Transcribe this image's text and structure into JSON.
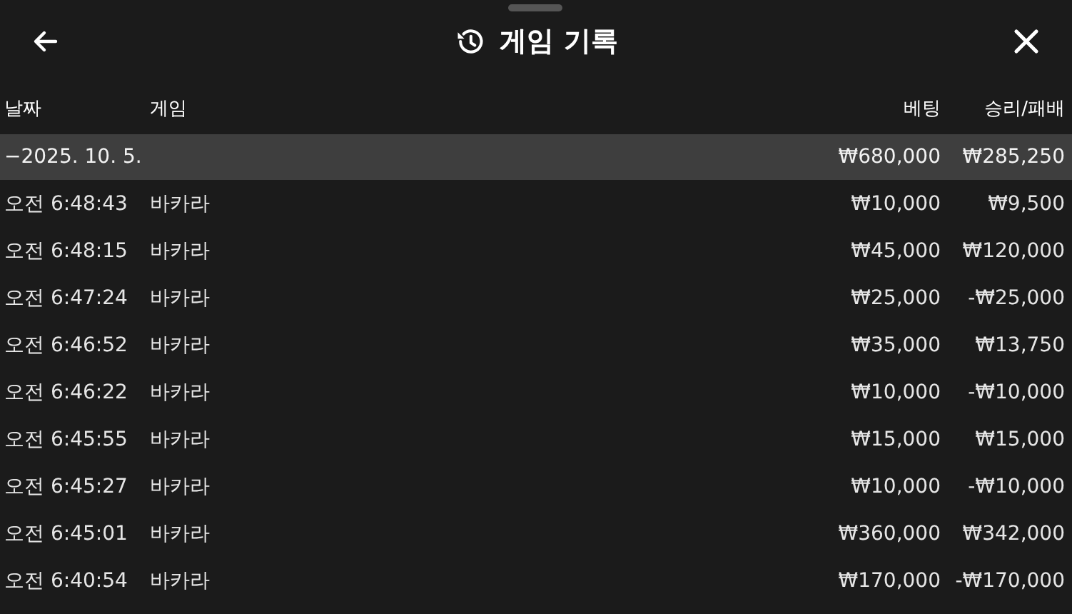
{
  "header": {
    "title": "게임 기록"
  },
  "table": {
    "columns": [
      "날짜",
      "게임",
      "베팅",
      "승리/패배"
    ],
    "group": {
      "label": "−2025. 10. 5.",
      "bet": "₩680,000",
      "result": "₩285,250"
    },
    "rows": [
      {
        "time": "오전 6:48:43",
        "game": "바카라",
        "bet": "₩10,000",
        "result": "₩9,500"
      },
      {
        "time": "오전 6:48:15",
        "game": "바카라",
        "bet": "₩45,000",
        "result": "₩120,000"
      },
      {
        "time": "오전 6:47:24",
        "game": "바카라",
        "bet": "₩25,000",
        "result": "-₩25,000"
      },
      {
        "time": "오전 6:46:52",
        "game": "바카라",
        "bet": "₩35,000",
        "result": "₩13,750"
      },
      {
        "time": "오전 6:46:22",
        "game": "바카라",
        "bet": "₩10,000",
        "result": "-₩10,000"
      },
      {
        "time": "오전 6:45:55",
        "game": "바카라",
        "bet": "₩15,000",
        "result": "₩15,000"
      },
      {
        "time": "오전 6:45:27",
        "game": "바카라",
        "bet": "₩10,000",
        "result": "-₩10,000"
      },
      {
        "time": "오전 6:45:01",
        "game": "바카라",
        "bet": "₩360,000",
        "result": "₩342,000"
      },
      {
        "time": "오전 6:40:54",
        "game": "바카라",
        "bet": "₩170,000",
        "result": "-₩170,000"
      }
    ]
  }
}
